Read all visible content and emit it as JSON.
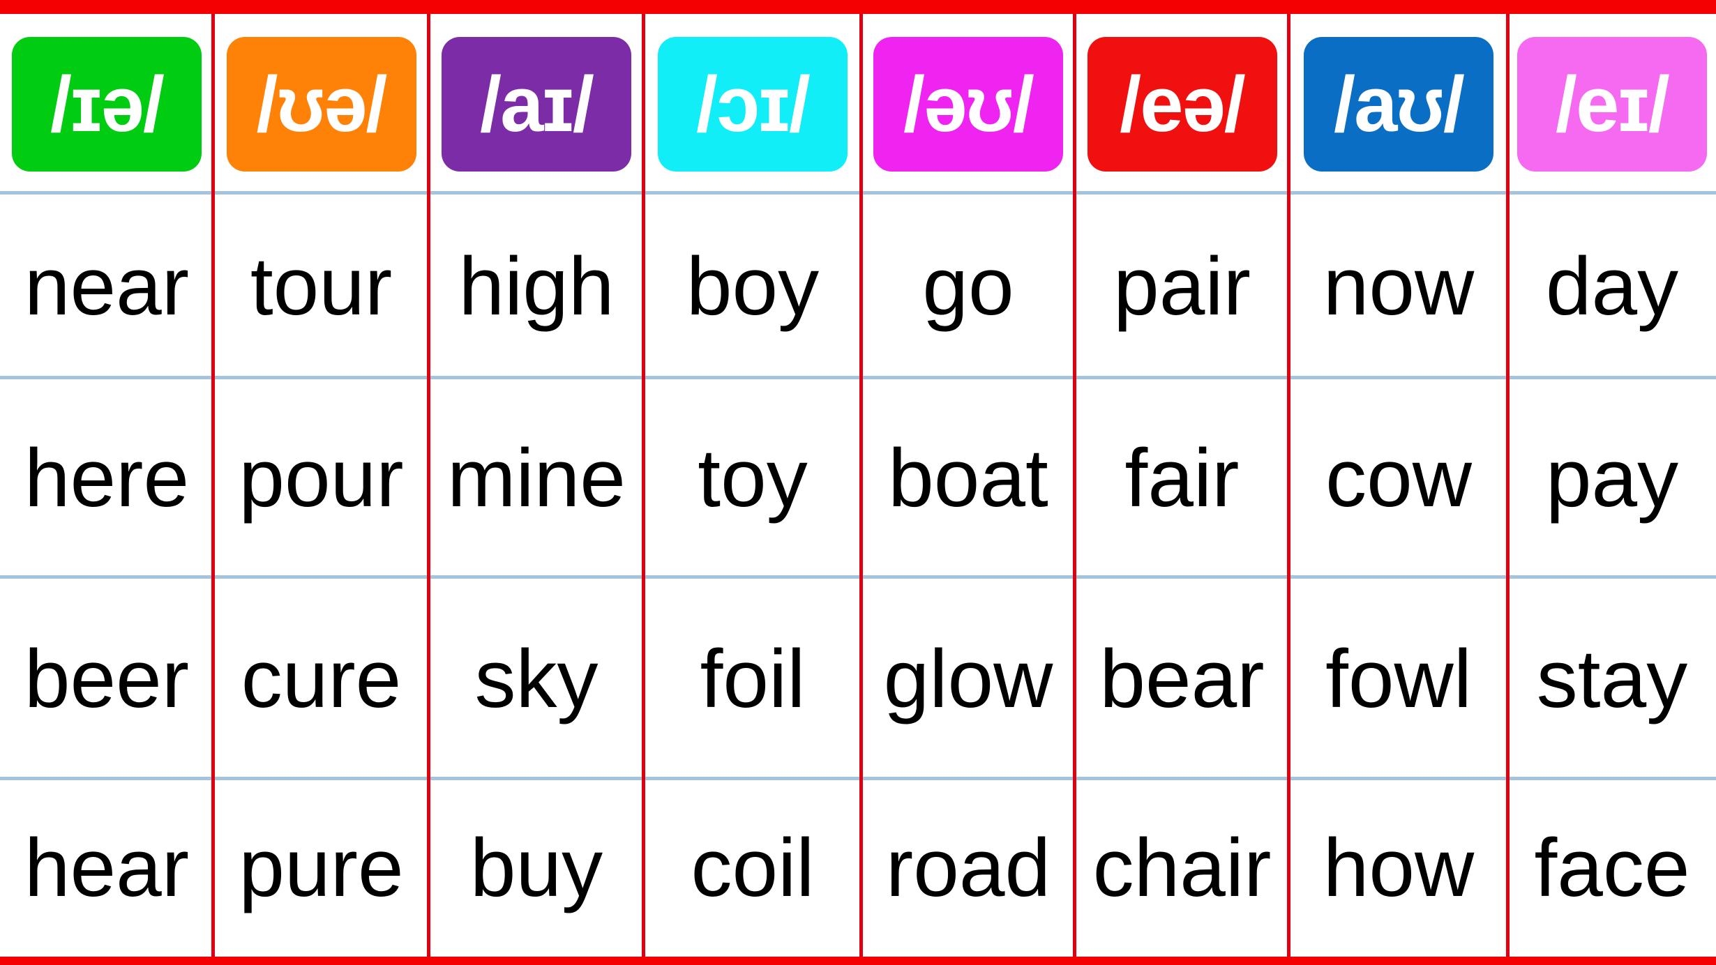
{
  "columns": [
    {
      "sound": "/ɪə/",
      "color": "#00cc11",
      "words": [
        "near",
        "here",
        "beer",
        "hear"
      ]
    },
    {
      "sound": "/ʊə/",
      "color": "#ff8208",
      "words": [
        "tour",
        "pour",
        "cure",
        "pure"
      ]
    },
    {
      "sound": "/aɪ/",
      "color": "#7b2ca6",
      "words": [
        "high",
        "mine",
        "sky",
        "buy"
      ]
    },
    {
      "sound": "/ɔɪ/",
      "color": "#11eef8",
      "words": [
        "boy",
        "toy",
        "foil",
        "coil"
      ]
    },
    {
      "sound": "/əʊ/",
      "color": "#f024f0",
      "words": [
        "go",
        "boat",
        "glow",
        "road"
      ]
    },
    {
      "sound": "/eə/",
      "color": "#f01010",
      "words": [
        "pair",
        "fair",
        "bear",
        "chair"
      ]
    },
    {
      "sound": "/aʊ/",
      "color": "#0a6ec4",
      "words": [
        "now",
        "cow",
        "fowl",
        "how"
      ]
    },
    {
      "sound": "/eɪ/",
      "color": "#f56af0",
      "words": [
        "day",
        "pay",
        "stay",
        "face"
      ]
    }
  ],
  "colors": {
    "border": "#f40000",
    "row_divider": "#a4c3dd"
  }
}
